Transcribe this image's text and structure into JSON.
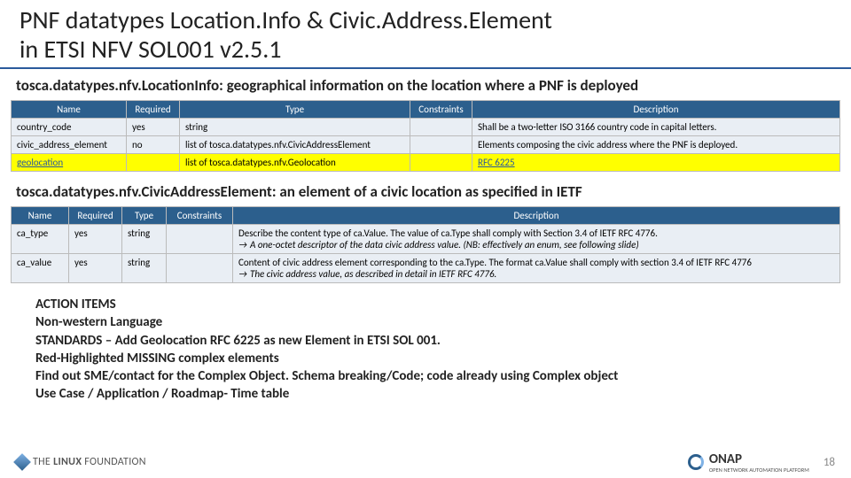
{
  "title_line1": "PNF datatypes Location.Info & Civic.Address.Element",
  "title_line2": "in ETSI NFV SOL001 v2.5.1",
  "section1": {
    "heading": "tosca.datatypes.nfv.LocationInfo: geographical information on the location where a PNF is deployed",
    "cols": {
      "name": "Name",
      "required": "Required",
      "type": "Type",
      "constraints": "Constraints",
      "description": "Description"
    },
    "rows": [
      {
        "name": "country_code",
        "required": "yes",
        "type": "string",
        "constraints": "",
        "description": "Shall be a two-letter ISO 3166 country code in capital letters.",
        "highlight": false
      },
      {
        "name": "civic_address_element",
        "required": "no",
        "type": "list of tosca.datatypes.nfv.CivicAddressElement",
        "constraints": "",
        "description": "Elements composing the civic address where the PNF is deployed.",
        "highlight": false
      },
      {
        "name": "geolocation",
        "required": "",
        "type": "list of tosca.datatypes.nfv.Geolocation",
        "constraints": "",
        "description": "RFC 6225",
        "highlight": true
      }
    ]
  },
  "section2": {
    "heading": "tosca.datatypes.nfv.CivicAddressElement: an element of a civic location as specified in IETF",
    "cols": {
      "name": "Name",
      "required": "Required",
      "type": "Type",
      "constraints": "Constraints",
      "description": "Description"
    },
    "rows": [
      {
        "name": "ca_type",
        "required": "yes",
        "type": "string",
        "constraints": "",
        "desc_main": "Describe the content type of ca.Value. The value of ca.Type shall comply with Section 3.4 of IETF RFC 4776.",
        "desc_sub": "A one-octet descriptor of the data civic address value. (NB: effectively an enum, see following slide)"
      },
      {
        "name": "ca_value",
        "required": "yes",
        "type": "string",
        "constraints": "",
        "desc_main": "Content of civic address element corresponding to the ca.Type. The format ca.Value shall comply with section 3.4 of IETF RFC 4776",
        "desc_sub": "The civic address value, as described in detail in IETF RFC 4776."
      }
    ]
  },
  "action_items": [
    "ACTION ITEMS",
    "Non-western Language",
    "STANDARDS – Add Geolocation RFC 6225 as new Element in ETSI SOL 001.",
    "Red-Highlighted MISSING complex elements",
    "Find out SME/contact for the Complex Object. Schema breaking/Code; code already using Complex object",
    "Use Case / Application / Roadmap- Time table"
  ],
  "footer": {
    "linux_the": "THE",
    "linux_lf": "LINUX",
    "linux_fd": "FOUNDATION",
    "onap": "ONAP",
    "onap_sub": "OPEN NETWORK AUTOMATION PLATFORM",
    "page": "18"
  }
}
